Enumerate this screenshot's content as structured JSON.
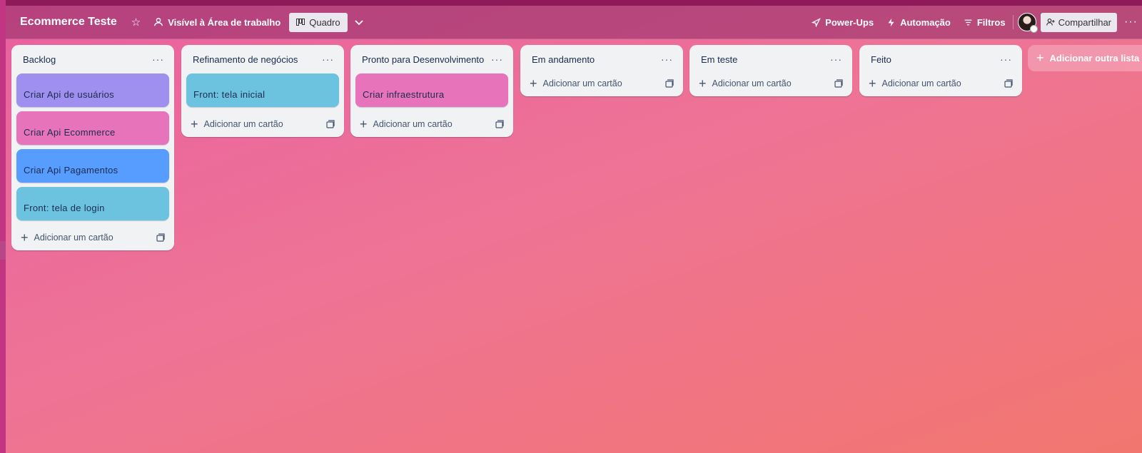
{
  "header": {
    "board_title": "Ecommerce Teste",
    "visibility_label": "Visível à Área de trabalho",
    "view_label": "Quadro",
    "powerups_label": "Power-Ups",
    "automation_label": "Automação",
    "filters_label": "Filtros",
    "share_label": "Compartilhar"
  },
  "lists": [
    {
      "title": "Backlog",
      "add_card_label": "Adicionar um cartão",
      "cards": [
        {
          "text": "Criar Api de usuários",
          "color": "#9f8fef"
        },
        {
          "text": "Criar Api Ecommerce",
          "color": "#e774bb"
        },
        {
          "text": "Criar Api Pagamentos",
          "color": "#579dff"
        },
        {
          "text": "Front: tela de login",
          "color": "#6cc3e0"
        }
      ]
    },
    {
      "title": "Refinamento de negócios",
      "add_card_label": "Adicionar um cartão",
      "cards": [
        {
          "text": "Front: tela inicial",
          "color": "#6cc3e0"
        }
      ]
    },
    {
      "title": "Pronto para Desenvolvimento",
      "add_card_label": "Adicionar um cartão",
      "cards": [
        {
          "text": "Criar infraestrutura",
          "color": "#e774bb"
        }
      ]
    },
    {
      "title": "Em andamento",
      "add_card_label": "Adicionar um cartão",
      "cards": []
    },
    {
      "title": "Em teste",
      "add_card_label": "Adicionar um cartão",
      "cards": []
    },
    {
      "title": "Feito",
      "add_card_label": "Adicionar um cartão",
      "cards": []
    }
  ],
  "add_list_label": "Adicionar outra lista",
  "list_menu_glyph": "···",
  "icons": {
    "star": "star-icon",
    "visibility": "people-icon",
    "view": "board-icon",
    "powerups": "rocket-icon",
    "automation": "lightning-icon",
    "filters": "filter-icon",
    "share": "add-person-icon",
    "more": "more-icon",
    "template": "card-template-icon"
  }
}
